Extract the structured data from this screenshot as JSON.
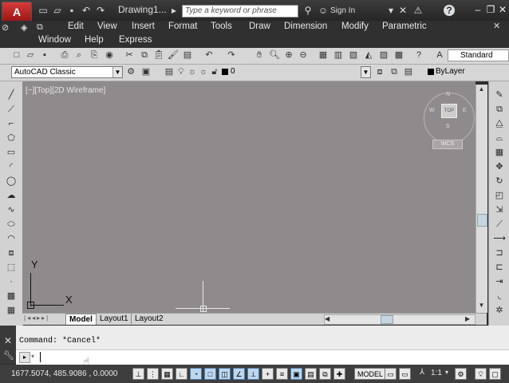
{
  "title_bar": {
    "logo_letter": "A",
    "document_title": "Drawing1...",
    "search_placeholder": "Type a keyword or phrase",
    "signin_label": "Sign In",
    "help_label": "?"
  },
  "menu": {
    "row1": [
      "Edit",
      "View",
      "Insert",
      "Format",
      "Tools",
      "Draw",
      "Dimension",
      "Modify",
      "Parametric"
    ],
    "row2": [
      "Window",
      "Help",
      "Express"
    ]
  },
  "toolbar": {
    "text_style": "Standard",
    "workspace": "AutoCAD Classic",
    "layer": "0",
    "color": "ByLayer"
  },
  "viewport": {
    "label": "[−][Top][2D Wireframe]",
    "compass": {
      "north": "N",
      "south": "S",
      "east": "E",
      "west": "W",
      "center": "TOP"
    },
    "wcs_label": "WCS",
    "ucs_x": "X",
    "ucs_y": "Y"
  },
  "layout_tabs": [
    "Model",
    "Layout1",
    "Layout2"
  ],
  "command": {
    "history": "Command: *Cancel*",
    "input_value": ""
  },
  "status": {
    "coordinates": "1677.5074, 485.9086 , 0.0000",
    "space": "MODEL",
    "scale": "1:1"
  }
}
